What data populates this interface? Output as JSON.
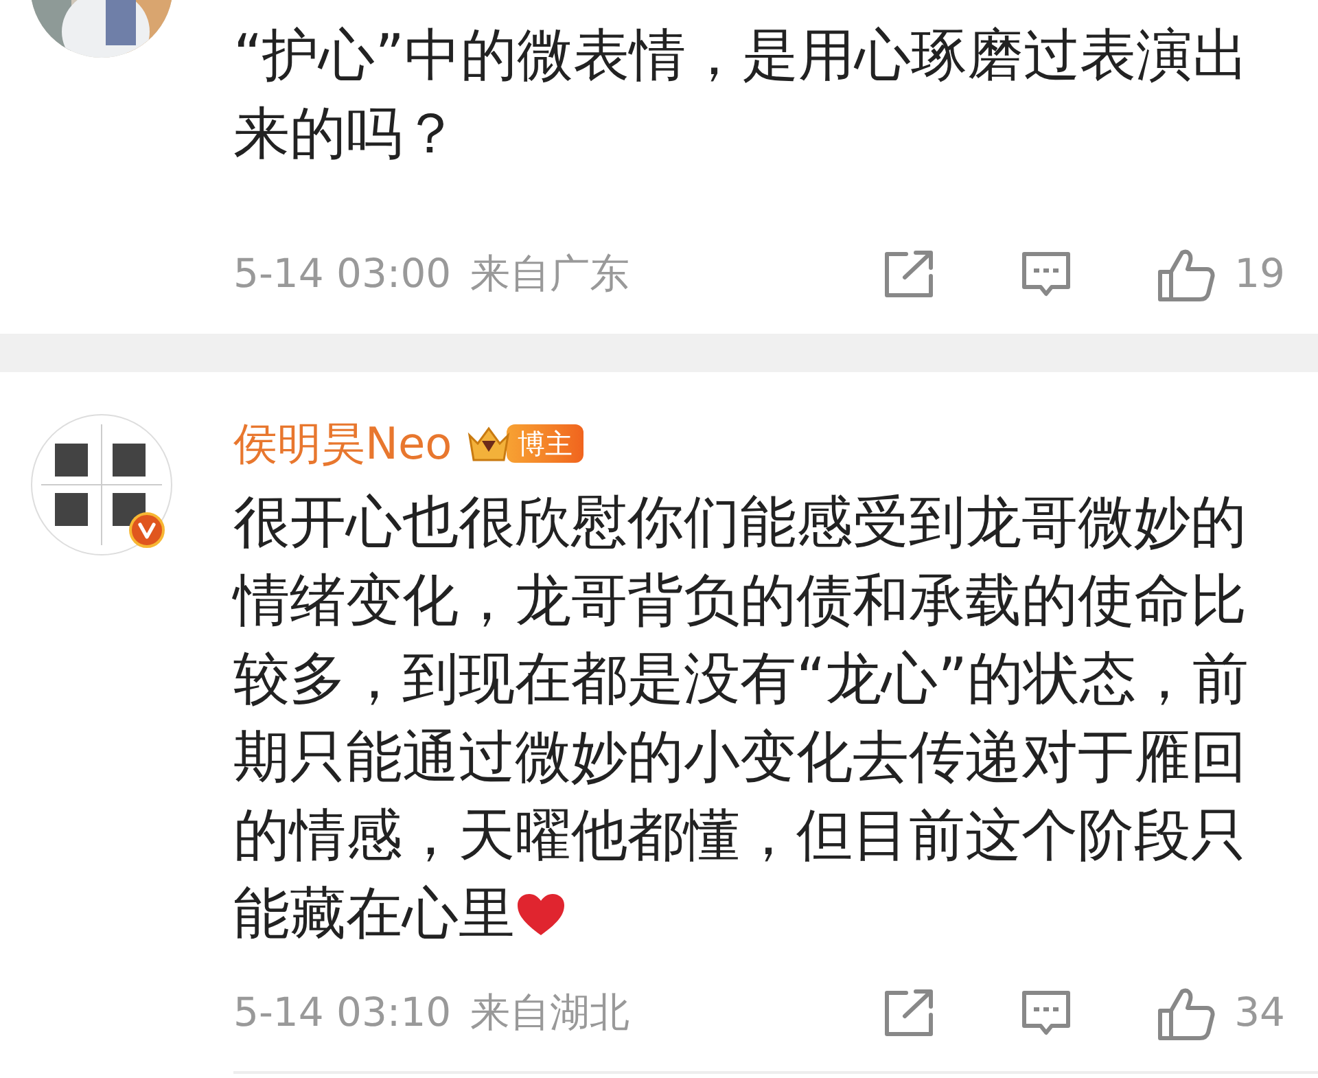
{
  "comments": [
    {
      "avatar": {
        "kind": "picture"
      },
      "text": "“护心”中的微表情，是用心琢磨过表演出来的吗？",
      "time": "5-14 03:00",
      "location": "来自广东",
      "likes": "19"
    },
    {
      "avatar": {
        "kind": "picture",
        "verified": true
      },
      "name": "侯明昊Neo",
      "badge": "博主",
      "text": "很开心也很欣慰你们能感受到龙哥微妙的情绪变化，龙哥背负的债和承载的使命比较多，到现在都是没有“龙心”的状态，前期只能通过微妙的小变化去传递对于雁回的情感，天曜他都懂，但目前这个阶段只能藏在心里",
      "heart": true,
      "time": "5-14 03:10",
      "location": "来自湖北",
      "likes": "34"
    }
  ]
}
